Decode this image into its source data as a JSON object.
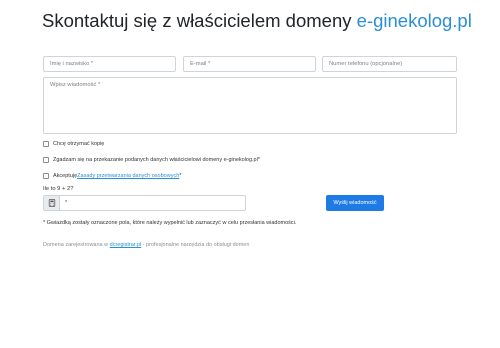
{
  "header": {
    "title_prefix": "Skontaktuj się z właścicielem domeny ",
    "domain": "e-ginekolog.pl"
  },
  "form": {
    "name_placeholder": "Imię i nazwisko *",
    "email_placeholder": "E-mail *",
    "phone_placeholder": "Numer telefonu (opcjonalne)",
    "message_placeholder": "Wpisz wiadomość *",
    "copy_label": "Chcę otrzymać kopię",
    "consent_label": "Zgadzam się na przekazanie podanych danych właścicielowi domeny e-ginekolog.pl*",
    "privacy_prefix": "Akceptuję ",
    "privacy_link": "Zasady przetwarzania danych osobowych",
    "privacy_suffix": "*",
    "captcha_question": "Ile to 9 + 2?",
    "captcha_placeholder": "*",
    "submit_label": "Wyślij wiadomość",
    "required_note": "* Gwiazdką zostały oznaczone pola, które należy wypełnić lub zaznaczyć w celu przesłania wiadomości."
  },
  "footer": {
    "prefix": "Domena zarejestrowana w ",
    "link": "dcregistrar.pl",
    "suffix": " - profesjonalne narzędzia do obsługi domen"
  },
  "colors": {
    "accent": "#2a8fd6",
    "button": "#1e7be6"
  }
}
